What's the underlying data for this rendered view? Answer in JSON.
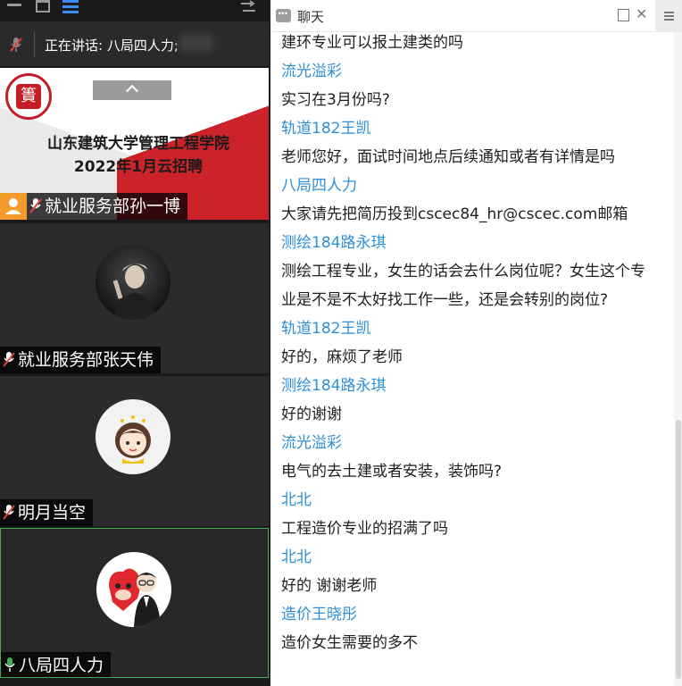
{
  "speaking_bar": {
    "text": "正在讲话: 八局四人力;"
  },
  "tiles": [
    {
      "name": "就业服务部孙一博",
      "slide_title": "山东建筑大学管理工程学院",
      "slide_subtitle": "2022年1月云招聘",
      "logo_char": "簣"
    },
    {
      "name": "就业服务部张天伟"
    },
    {
      "name": "明月当空"
    },
    {
      "name": "八局四人力"
    }
  ],
  "chat": {
    "title": "聊天",
    "messages": [
      {
        "kind": "text",
        "value": "建环专业可以报土建类的吗"
      },
      {
        "kind": "sender",
        "value": "流光溢彩"
      },
      {
        "kind": "text",
        "value": "实习在3月份吗?"
      },
      {
        "kind": "sender",
        "value": "轨道182王凯"
      },
      {
        "kind": "text",
        "value": "老师您好，面试时间地点后续通知或者有详情是吗"
      },
      {
        "kind": "sender",
        "value": "八局四人力"
      },
      {
        "kind": "text",
        "value": "大家请先把简历投到cscec84_hr@cscec.com邮箱"
      },
      {
        "kind": "sender",
        "value": "测绘184路永琪"
      },
      {
        "kind": "text",
        "value": "测绘工程专业，女生的话会去什么岗位呢？女生这个专"
      },
      {
        "kind": "text",
        "value": "业是不是不太好找工作一些，还是会转别的岗位?"
      },
      {
        "kind": "sender",
        "value": "轨道182王凯"
      },
      {
        "kind": "text",
        "value": "好的，麻烦了老师"
      },
      {
        "kind": "sender",
        "value": "测绘184路永琪"
      },
      {
        "kind": "text",
        "value": "好的谢谢"
      },
      {
        "kind": "sender",
        "value": "流光溢彩"
      },
      {
        "kind": "text",
        "value": "电气的去土建或者安装，装饰吗?"
      },
      {
        "kind": "sender",
        "value": "北北"
      },
      {
        "kind": "text",
        "value": "工程造价专业的招满了吗"
      },
      {
        "kind": "sender",
        "value": "北北"
      },
      {
        "kind": "text",
        "value": "好的 谢谢老师"
      },
      {
        "kind": "sender",
        "value": "造价王晓彤"
      },
      {
        "kind": "text",
        "value": "造价女生需要的多不"
      }
    ]
  },
  "colors": {
    "sender": "#2f8fd6",
    "text": "#1e1e1e",
    "active_border": "#3fae55",
    "accent": "#3d8cff",
    "host_badge": "#f59b2b"
  },
  "icons": [
    "minimize-icon",
    "maximize-icon",
    "list-view-icon",
    "swap-icon",
    "mic-muted-icon",
    "mic-active-icon",
    "chat-icon",
    "popout-icon",
    "close-icon",
    "menu-icon",
    "collapse-up-icon",
    "host-icon"
  ]
}
